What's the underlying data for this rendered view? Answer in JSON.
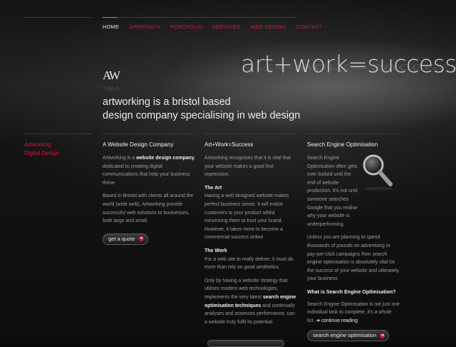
{
  "nav": {
    "items": [
      {
        "label": "HOME",
        "current": true
      },
      {
        "label": "APPROACH"
      },
      {
        "label": "PORTFOLIO"
      },
      {
        "label": "SERVICES"
      },
      {
        "label": "WEB DESIGN"
      },
      {
        "label": "CONTACT"
      }
    ]
  },
  "hero": {
    "logo": "AW",
    "slogan": "art+work=success",
    "tagline_line1": "artworking is a bristol based",
    "tagline_line2": "design company specialising in web design"
  },
  "sidebar": {
    "items": [
      "Artworking",
      "Digital Design"
    ]
  },
  "col1": {
    "heading": "A Website Design Company",
    "p1_pre": "Artworking is a ",
    "p1_bold": "website design company",
    "p1_post": ", dedicated to creating digital communications that help your business thrive.",
    "p2": "Based in Bristol with clients all around the world (wide web), Artworking provide successful web solutions to businesses, both large and small.",
    "button": "get a quote"
  },
  "col2": {
    "heading": "Art+Work=Success",
    "intro": "Artworking recognises that it is vital that your website makes a good first impression.",
    "sub1": "The Art",
    "p1": "Having a well designed website makes perfect business sense. It will entice customers to your product whilst convincing them to trust your brand. However, it takes more to become a commercial success online.",
    "sub2": "The Work",
    "p2": "For a web site to really deliver, it must do more than rely on good aesthetics.",
    "p3_pre": "Only by having a website strategy that utilises modern web technologies, implements the very latest ",
    "p3_bold": "search engine optimisation techniques",
    "p3_post": " and continually analyses and assesses performance, can a website truly fulfil its potential."
  },
  "col3": {
    "heading": "Search Engine Optimisation",
    "p1": "Search Engine Optimisation often gets over looked until the end of website production. It's not until someone searches Google that you realise why your website is underperforming.",
    "p2": "Unless you are planning to spend thousands of pounds on advertising or pay-per-click campaigns then search engine optimisation is absolutely vital for the success of your website and ultimately your business.",
    "question": "What is Search Engine Optimisation?",
    "p3": "Search Engine Optimisation is not just one individual task to complete, it's a whole list.",
    "continue_link": "continue reading",
    "button": "search engine optimisation"
  },
  "colors": {
    "accent": "#d1163b",
    "background": "#0a0a0a"
  },
  "icons": {
    "search": "magnifier-icon",
    "arrow": "arrow-right-icon"
  }
}
